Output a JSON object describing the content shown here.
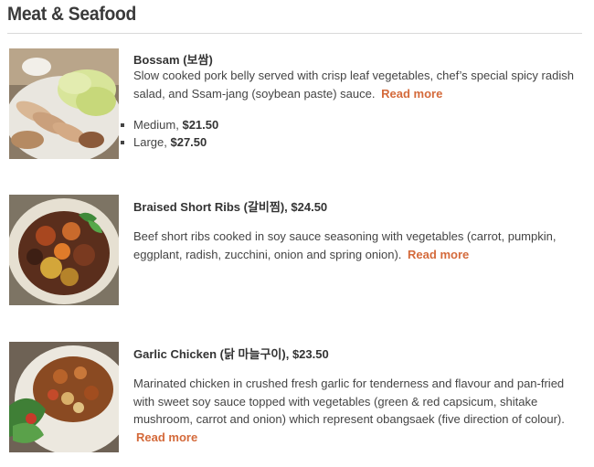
{
  "section": {
    "title": "Meat & Seafood"
  },
  "items": [
    {
      "name": "Bossam (보쌈)",
      "description": "Slow cooked pork belly served with crisp leaf vegetables, chef’s special spicy radish salad, and Ssam-jang (soybean paste) sauce.",
      "read_more": "Read more",
      "sizes": [
        {
          "label": "Medium, ",
          "price": "$21.50"
        },
        {
          "label": "Large, ",
          "price": "$27.50"
        }
      ]
    },
    {
      "name": "Braised Short Ribs (갈비찜), $24.50",
      "description": "Beef short ribs cooked in soy sauce seasoning with vegetables (carrot, pumpkin, eggplant, radish, zucchini, onion and spring onion).",
      "read_more": "Read more"
    },
    {
      "name": "Garlic Chicken (닭 마늘구이), $23.50",
      "description": "Marinated chicken in crushed fresh garlic for tenderness and flavour and pan-fried with sweet soy sauce topped with vegetables (green & red capsicum, shitake mushroom, carrot and onion) which represent obangsaek (five direction of colour).",
      "read_more": "Read more"
    }
  ]
}
